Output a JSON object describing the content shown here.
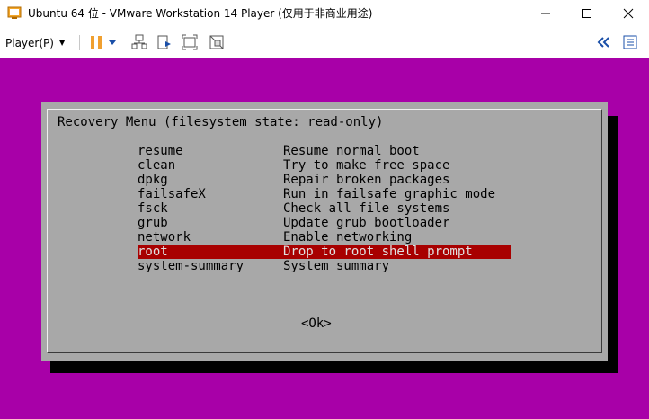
{
  "window": {
    "title": "Ubuntu 64 位 - VMware Workstation 14 Player (仅用于非商业用途)",
    "icon": "vmware-player-icon"
  },
  "toolbar": {
    "player_menu": "Player(P)",
    "icons": [
      "pause-icon",
      "dropdown-caret-icon",
      "network-adapter-icon",
      "removable-device-icon",
      "fullscreen-icon",
      "unity-icon",
      "collapse-double-chevron-icon",
      "library-icon"
    ]
  },
  "recovery": {
    "title": "Recovery Menu (filesystem state: read-only)",
    "items": [
      {
        "key": "resume",
        "desc": "Resume normal boot"
      },
      {
        "key": "clean",
        "desc": "Try to make free space"
      },
      {
        "key": "dpkg",
        "desc": "Repair broken packages"
      },
      {
        "key": "failsafeX",
        "desc": "Run in failsafe graphic mode"
      },
      {
        "key": "fsck",
        "desc": "Check all file systems"
      },
      {
        "key": "grub",
        "desc": "Update grub bootloader"
      },
      {
        "key": "network",
        "desc": "Enable networking"
      },
      {
        "key": "root",
        "desc": "Drop to root shell prompt"
      },
      {
        "key": "system-summary",
        "desc": "System summary"
      }
    ],
    "selected_item": "root",
    "ok_label": "<Ok>"
  },
  "colors": {
    "vm_background": "#a800a8",
    "dialog_background": "#a8a8a8",
    "selection": "#a80000",
    "shadow": "#000000"
  }
}
